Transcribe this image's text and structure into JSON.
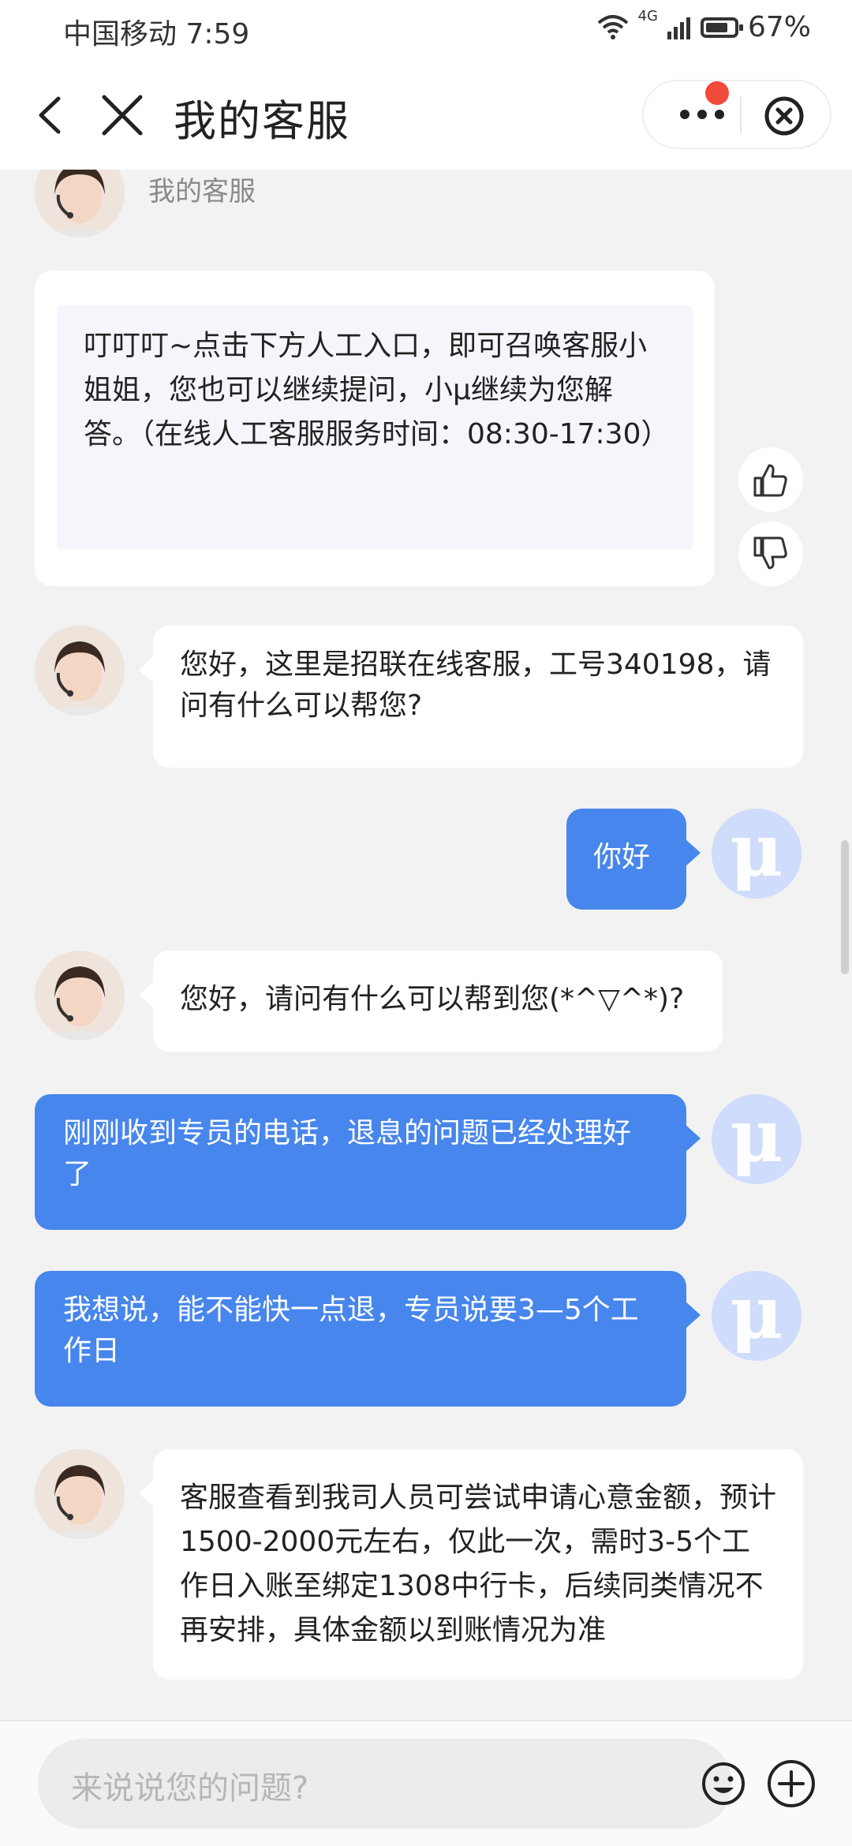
{
  "status_bar": {
    "carrier_time": "中国移动 7:59",
    "network": "4G",
    "battery": "67%"
  },
  "header": {
    "title": "我的客服"
  },
  "chat": {
    "agent_name": "我的客服",
    "system_card": "叮叮叮~点击下方人工入口，即可召唤客服小姐姐，您也可以继续提问，小μ继续为您解答。（在线人工客服服务时间：08:30-17:30）",
    "user_avatar_glyph": "μ",
    "messages": [
      {
        "from": "agent",
        "text": "您好，这里是招联在线客服，工号340198，请问有什么可以帮您?"
      },
      {
        "from": "user",
        "text": "你好"
      },
      {
        "from": "agent",
        "text": "您好，请问有什么可以帮到您(*^▽^*)?"
      },
      {
        "from": "user",
        "text": "刚刚收到专员的电话，退息的问题已经处理好了"
      },
      {
        "from": "user",
        "text": "我想说，能不能快一点退，专员说要3—5个工作日"
      },
      {
        "from": "agent",
        "text": "客服查看到我司人员可尝试申请心意金额，预计1500-2000元左右，仅此一次，需时3-5个工作日入账至绑定1308中行卡，后续同类情况不再安排，具体金额以到账情况为准"
      }
    ]
  },
  "input": {
    "placeholder": "来说说您的问题?"
  },
  "colors": {
    "accent": "#4786ec",
    "user_avatar_bg": "#cfdcfb",
    "badge": "#f04a3a"
  },
  "icons": [
    "back-arrow-icon",
    "close-x-icon",
    "more-dots-icon",
    "circle-close-icon",
    "thumbs-up-icon",
    "thumbs-down-icon",
    "emoji-icon",
    "plus-circle-icon"
  ]
}
